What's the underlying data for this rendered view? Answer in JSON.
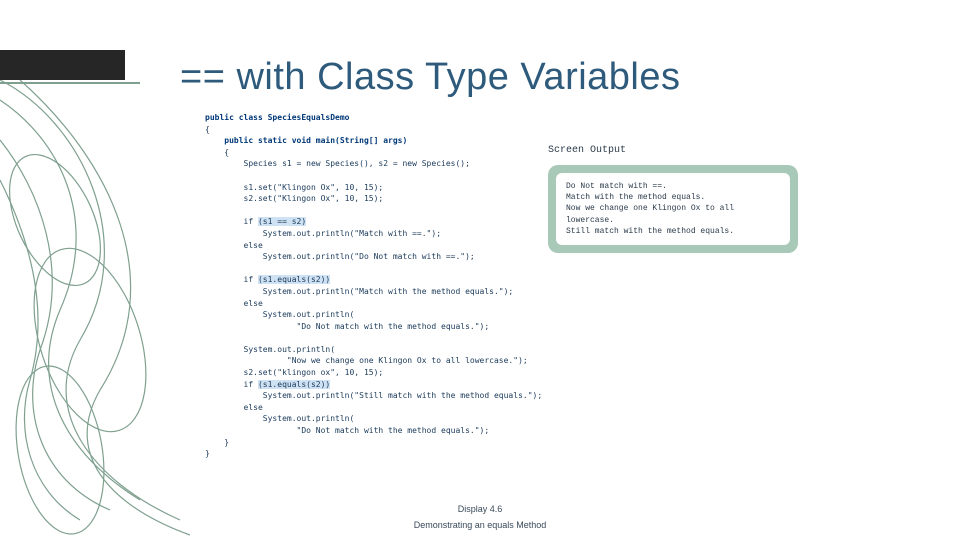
{
  "title": "== with Class Type Variables",
  "code": {
    "l1": "public class SpeciesEqualsDemo",
    "l2": "{",
    "l3": "    public static void main(String[] args)",
    "l4": "    {",
    "l5": "        Species s1 = new Species(), s2 = new Species();",
    "l6": "",
    "l7": "        s1.set(\"Klingon Ox\", 10, 15);",
    "l8": "        s2.set(\"Klingon Ox\", 10, 15);",
    "l9": "",
    "l10a": "        if ",
    "l10b": "(s1 == s2)",
    "l11": "            System.out.println(\"Match with ==.\");",
    "l12": "        else",
    "l13": "            System.out.println(\"Do Not match with ==.\");",
    "l14": "",
    "l15a": "        if ",
    "l15b": "(s1.equals(s2))",
    "l16": "            System.out.println(\"Match with the method equals.\");",
    "l17": "        else",
    "l18": "            System.out.println(",
    "l19": "                   \"Do Not match with the method equals.\");",
    "l20": "",
    "l21": "        System.out.println(",
    "l22": "                 \"Now we change one Klingon Ox to all lowercase.\");",
    "l23": "        s2.set(\"klingon ox\", 10, 15);",
    "l24a": "        if ",
    "l24b": "(s1.equals(s2))",
    "l25": "            System.out.println(\"Still match with the method equals.\");",
    "l26": "        else",
    "l27": "            System.out.println(",
    "l28": "                   \"Do Not match with the method equals.\");",
    "l29": "    }",
    "l30": "}"
  },
  "output_label": "Screen Output",
  "output": {
    "l1": "Do Not match with ==.",
    "l2": "Match with the method equals.",
    "l3": "Now we change one Klingon Ox to all lowercase.",
    "l4": "Still match with the method equals."
  },
  "caption": {
    "display": "Display 4.6",
    "name": "Demonstrating an equals Method"
  }
}
